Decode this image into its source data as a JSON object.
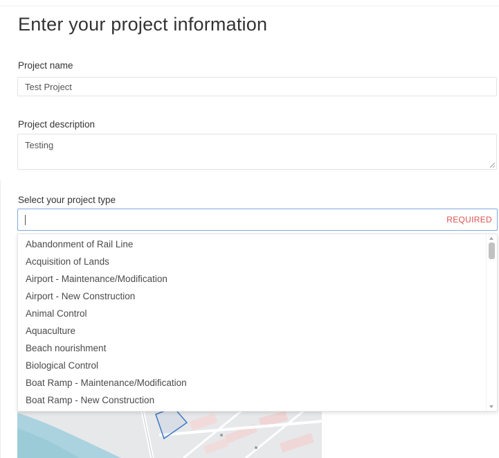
{
  "form": {
    "title": "Enter your project information",
    "project_name": {
      "label": "Project name",
      "value": "Test Project"
    },
    "project_description": {
      "label": "Project description",
      "value": "Testing"
    },
    "project_type": {
      "label": "Select your project type",
      "value": "",
      "required_label": "REQUIRED"
    }
  },
  "dropdown": {
    "options": [
      "Abandonment of Rail Line",
      "Acquisition of Lands",
      "Airport - Maintenance/Modification",
      "Airport - New Construction",
      "Animal Control",
      "Aquaculture",
      "Beach nourishment",
      "Biological Control",
      "Boat Ramp - Maintenance/Modification",
      "Boat Ramp - New Construction"
    ]
  },
  "colors": {
    "focus_border": "#7fa8dc",
    "required_text": "#d9534f",
    "text_primary": "#333333",
    "polygon_stroke": "#3b78c4"
  },
  "icons": {
    "textarea_resize": "resize-grip-icon",
    "scroll_up": "chevron-up-icon",
    "scroll_down": "chevron-down-icon"
  }
}
